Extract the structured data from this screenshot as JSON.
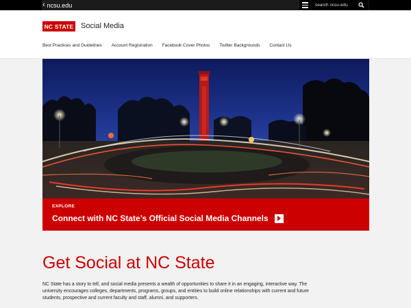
{
  "utility": {
    "back_label": "ncsu.edu",
    "search_placeholder": "search ncsu.edu"
  },
  "header": {
    "logo_text": "NC STATE",
    "site_title": "Social Media"
  },
  "nav": {
    "items": [
      "Best Practices and Guidelines",
      "Account Registration",
      "Facebook Cover Photos",
      "Twitter Backgrounds",
      "Contact Us"
    ]
  },
  "hero": {
    "eyebrow": "EXPLORE",
    "link_text": "Connect with NC State’s Official Social Media Channels"
  },
  "content": {
    "heading": "Get Social at NC State",
    "intro": "NC State has a story to tell, and social media presents a wealth of opportunities to share it in an engaging, interactive way. The university encourages colleges, departments, programs, groups, and entities to build online relationships with current and future students, prospective and current faculty and staff, alumni, and supporters."
  },
  "colors": {
    "brand_red": "#cc0000",
    "utility_bar": "#000000",
    "page_background": "#f2f2f2"
  },
  "icons": [
    "chevron-left-icon",
    "menu-icon",
    "search-icon",
    "chevron-right-icon"
  ]
}
